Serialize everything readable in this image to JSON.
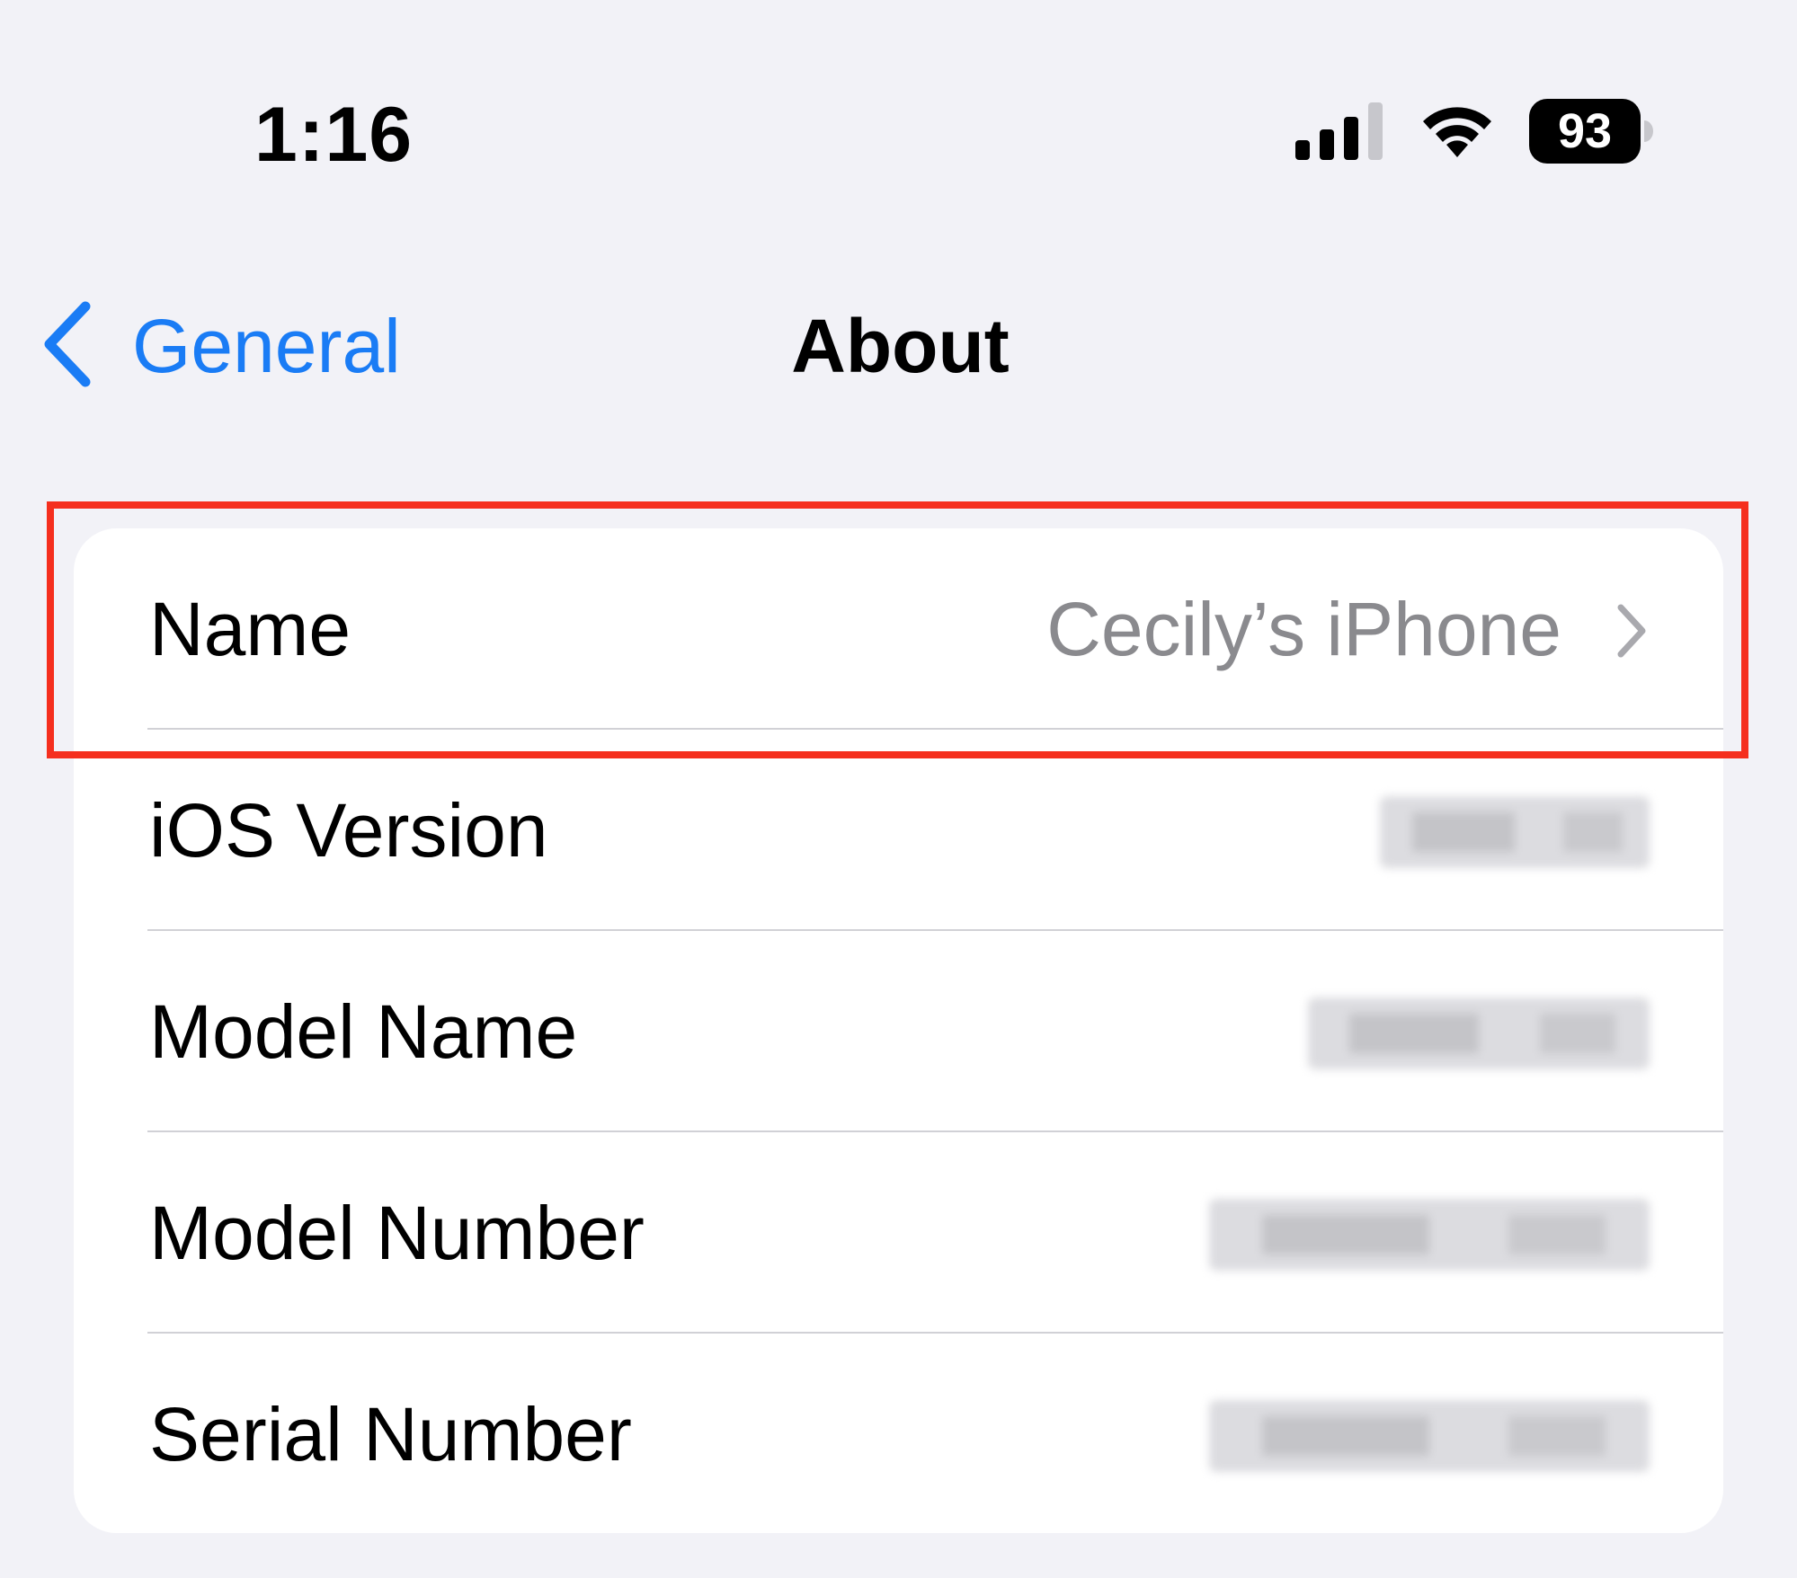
{
  "status_bar": {
    "time": "1:16",
    "battery_level": "93",
    "icons": [
      "cellular-signal-icon",
      "wifi-icon",
      "battery-icon"
    ]
  },
  "nav": {
    "back_label": "General",
    "title": "About"
  },
  "about_list": {
    "rows": [
      {
        "label": "Name",
        "value": "Cecily’s iPhone",
        "has_chevron": true
      },
      {
        "label": "iOS Version",
        "value_redacted": true
      },
      {
        "label": "Model Name",
        "value_redacted": true
      },
      {
        "label": "Model Number",
        "value_redacted": true
      },
      {
        "label": "Serial Number",
        "value_redacted": true
      }
    ]
  },
  "colors": {
    "background": "#f2f2f7",
    "card": "#ffffff",
    "accent_blue": "#1a7cf5",
    "secondary_text": "#8a8a8e",
    "highlight_red": "#f52f1e"
  }
}
